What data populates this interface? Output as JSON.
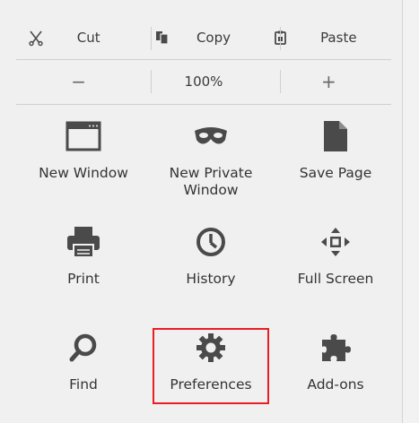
{
  "edit": {
    "cut_label": "Cut",
    "copy_label": "Copy",
    "paste_label": "Paste"
  },
  "zoom": {
    "minus_label": "−",
    "level": "100%",
    "plus_label": "+"
  },
  "items": [
    {
      "label": "New Window",
      "icon": "window-icon"
    },
    {
      "label": "New Private\nWindow",
      "icon": "mask-icon"
    },
    {
      "label": "Save Page",
      "icon": "page-icon"
    },
    {
      "label": "Print",
      "icon": "printer-icon"
    },
    {
      "label": "History",
      "icon": "clock-icon"
    },
    {
      "label": "Full Screen",
      "icon": "fullscreen-icon"
    },
    {
      "label": "Find",
      "icon": "magnifier-icon"
    },
    {
      "label": "Preferences",
      "icon": "gear-icon"
    },
    {
      "label": "Add-ons",
      "icon": "puzzle-icon"
    }
  ],
  "colors": {
    "icon": "#4a4a4a",
    "highlight": "#ea1d24"
  }
}
